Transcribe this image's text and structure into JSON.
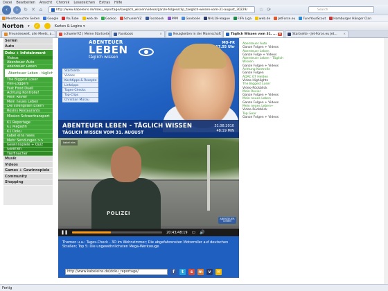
{
  "menubar": [
    "Datei",
    "Bearbeiten",
    "Ansicht",
    "Chronik",
    "Lesezeichen",
    "Extras",
    "Hilfe"
  ],
  "url": "http://www.kabeleins.de/doku_reportage/kaeglich_wissen/videos/ganze-folgen/clip_taeglich-wissen-vom-31-august_30229/",
  "search_placeholder": "Search",
  "bookmarks": [
    {
      "label": "Meistbesuchte Seiten",
      "color": "#e08a2a"
    },
    {
      "label": "Google",
      "color": "#3c74d6"
    },
    {
      "label": "YouTube",
      "color": "#d62a2a"
    },
    {
      "label": "web.de",
      "color": "#f2c300"
    },
    {
      "label": "Gooloo",
      "color": "#2ea84a"
    },
    {
      "label": "SchuelerVZ",
      "color": "#d64a3a"
    },
    {
      "label": "Facebook",
      "color": "#3b5998"
    },
    {
      "label": "PPM",
      "color": "#8a5bc4"
    },
    {
      "label": "Gooloolie",
      "color": "#4a8ad6"
    },
    {
      "label": "NHL18-league",
      "color": "#2b3a67"
    },
    {
      "label": "FIFA Liga",
      "color": "#1e8a4a"
    },
    {
      "label": "web.de",
      "color": "#f2c300"
    },
    {
      "label": "JetForce.eu",
      "color": "#e0582a"
    },
    {
      "label": "TuneYourScout",
      "color": "#2a8ad6"
    },
    {
      "label": "Hamburger Hänger Clan",
      "color": "#c43a3a"
    }
  ],
  "norton": {
    "logo": "Norton",
    "dropdown": "▾",
    "menu": "Karten & Logins ▾"
  },
  "tabs": [
    {
      "label": "Freundeswelt, alle Meets, a...",
      "color": "#e08a2a",
      "active": false
    },
    {
      "label": "schuelerVZ | Meine Startseite",
      "color": "#d64a3a",
      "active": false
    },
    {
      "label": "Facebook",
      "color": "#3b5998",
      "active": false
    },
    {
      "label": "Neuigkeiten in der Mannschaft",
      "color": "#4a8ad6",
      "active": false
    },
    {
      "label": "Täglich Wissen vom 31. ...",
      "color": "#1f5fbf",
      "active": true
    },
    {
      "label": "Startseite - Jet-Force.eu Jet...",
      "color": "#2b3a67",
      "active": false
    }
  ],
  "sidebar": {
    "heads_top": [
      "Serien",
      "Auto"
    ],
    "section": "Doku + Infotainment",
    "items": [
      {
        "label": "Videos",
        "cls": "dark"
      },
      {
        "label": "Abenteuer Auto",
        "cls": ""
      },
      {
        "label": "Abenteuer Leben",
        "cls": ""
      },
      {
        "label": "Abenteuer Leben - täglich Wissen",
        "cls": "active"
      },
      {
        "label": "The Biggest Loser",
        "cls": ""
      },
      {
        "label": "Heli-Loggers",
        "cls": ""
      },
      {
        "label": "Fast Food Duell",
        "cls": ""
      },
      {
        "label": "Achtung Kontrolle!",
        "cls": ""
      },
      {
        "label": "Mein Revier",
        "cls": ""
      },
      {
        "label": "Mein neues Leben",
        "cls": ""
      },
      {
        "label": "Die strengsten Eltern",
        "cls": ""
      },
      {
        "label": "Rosins Restaurants",
        "cls": ""
      },
      {
        "label": "Mission Schwertransport",
        "cls": "tall"
      },
      {
        "label": "K1 Reportage",
        "cls": ""
      },
      {
        "label": "K1 Magazin",
        "cls": ""
      },
      {
        "label": "K1 Doku",
        "cls": ""
      },
      {
        "label": "kabel eins news",
        "cls": ""
      },
      {
        "label": "Mehr Sendungen >>",
        "cls": ""
      },
      {
        "label": "Gewinnspiele + Quiz",
        "cls": "dark"
      },
      {
        "label": "Galerien",
        "cls": "dark"
      },
      {
        "label": "Tierfinacher",
        "cls": "dark"
      }
    ],
    "heads_bottom": [
      "Musik",
      "Videos",
      "Games + Gewinnspiele",
      "Community",
      "Shopping"
    ]
  },
  "header": {
    "logo_top": "ABENTEUER",
    "logo_main": "LEBEN",
    "logo_sub": "täglich wissen",
    "time_day": "MO-FR",
    "time_clock": "17.55 Uhr",
    "menu": [
      "Startseite",
      "Videos",
      "Kochtipps & Rezepte",
      "Linktipps",
      "Tages-Checks",
      "Top-Clips",
      "Christian Mürau"
    ],
    "title": "ABENTEUER LEBEN - TÄGLICH WISSEN",
    "subtitle": "TÄGLICH WISSEN VOM 31. AUGUST",
    "date": "31.08.2010",
    "duration": "48:19 MIN"
  },
  "video": {
    "channel_logo": "kabel eins",
    "polizei": "POLIZEI",
    "corner_badge": "ABENTEUER LEBEN",
    "time": "20:43/48:19",
    "progress": 0.43
  },
  "description": "Themen u.a.: Tages-Check - 3D im Wohnzimmer; Die abgefahrensten Motorroller auf deutschen Straßen; Top 5: Die ungewöhnlichsten Mega-Werkzeuge",
  "share_url": "http://www.kabeleins.de/doku_reportage/",
  "share_icons": [
    {
      "name": "facebook-icon",
      "glyph": "f",
      "color": "#3b5998"
    },
    {
      "name": "twitter-icon",
      "glyph": "t",
      "color": "#2aa3d6"
    },
    {
      "name": "schuelervz-icon",
      "glyph": "s",
      "color": "#d64a3a"
    },
    {
      "name": "meinvz-icon",
      "glyph": "m",
      "color": "#e07a2a"
    },
    {
      "name": "studivz-icon",
      "glyph": "v",
      "color": "#2b3a67"
    },
    {
      "name": "mail-icon",
      "glyph": "✉",
      "color": "#f2b600"
    }
  ],
  "related": [
    {
      "link": "Abenteuer Auto",
      "text": "Ganze Folgen + Videos"
    },
    {
      "link": "Abenteuer Leben",
      "text": "Ganze Folge + Videos"
    },
    {
      "link": "Abenteuer Leben - Täglich Wissen",
      "text": "Ganze Folgen + Videos"
    },
    {
      "link": "Achtung Kontrolle",
      "text": "Ganze Folgen"
    },
    {
      "link": "ADAC 07 Helden",
      "text": "Video-Highlights"
    },
    {
      "link": "The Biggest Loser",
      "text": "Video-Rückblick"
    },
    {
      "link": "Mein Revier",
      "text": "Ganze Folgen + Videos"
    },
    {
      "link": "Mein neues Leben",
      "text": "Ganze Folgen + Videos"
    },
    {
      "link": "Mein neues Leben+",
      "text": "Video-Rückblick"
    },
    {
      "link": "Top Gear",
      "text": "Ganze Folgen + Videos"
    }
  ],
  "status": "Fertig"
}
